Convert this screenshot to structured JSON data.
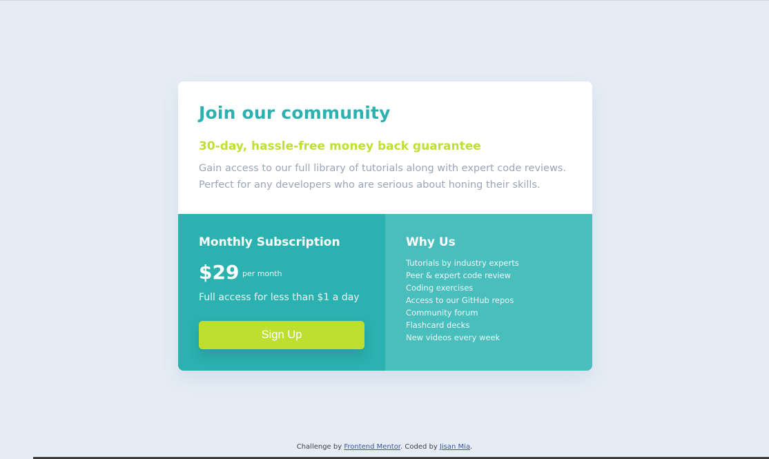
{
  "header": {
    "title": "Join our community",
    "subtitle": "30-day, hassle-free money back guarantee",
    "description": "Gain access to our full library of tutorials along with expert code reviews. Perfect for any developers who are serious about honing their skills."
  },
  "subscription": {
    "title": "Monthly Subscription",
    "price": "$29",
    "period": "per month",
    "access_text": "Full access for less than $1 a day",
    "button_label": "Sign Up"
  },
  "why_us": {
    "title": "Why Us",
    "items": [
      "Tutorials by industry experts",
      "Peer & expert code review",
      "Coding exercises",
      "Access to our GitHub repos",
      "Community forum",
      "Flashcard decks",
      "New videos every week"
    ]
  },
  "footer": {
    "prefix": "Challenge by ",
    "challenge_link": "Frontend Mentor",
    "middle": ". Coded by ",
    "author_link": "Jisan Mia",
    "suffix": "."
  },
  "colors": {
    "background": "#e5ecf4",
    "primary": "#2bb1af",
    "secondary": "#4abebd",
    "accent": "#bfdf30",
    "text_muted": "#9aa5b8"
  }
}
